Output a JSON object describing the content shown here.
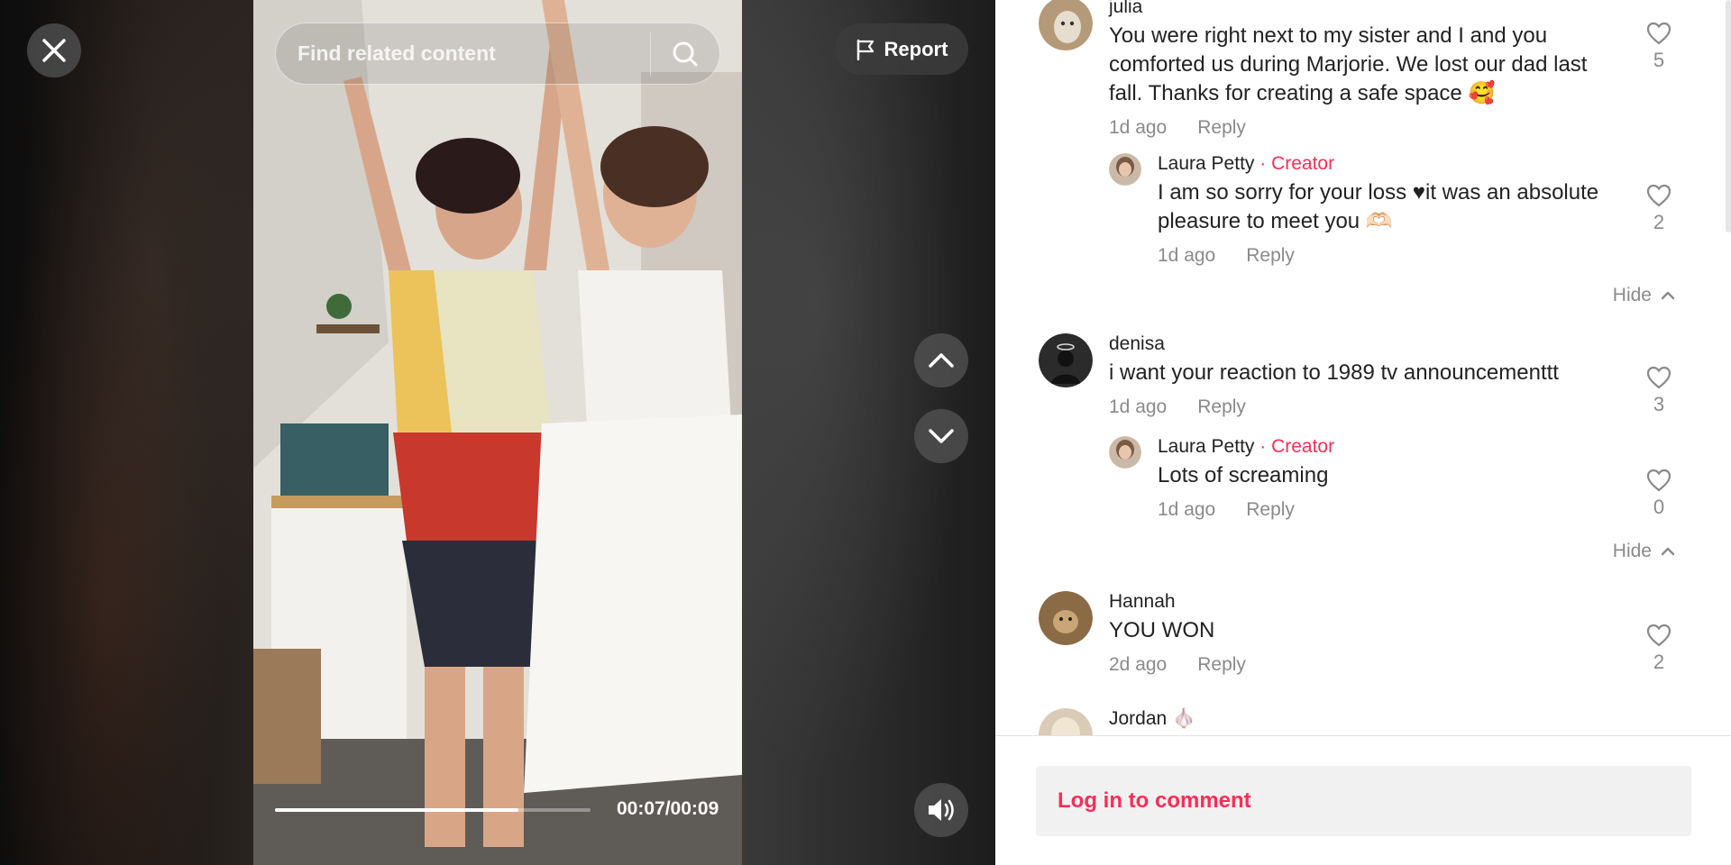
{
  "video": {
    "close_icon": "close-icon",
    "search_placeholder": "Find related content",
    "search_icon": "search-icon",
    "report_label": "Report",
    "report_icon": "flag-icon",
    "nav_up_icon": "chevron-up-icon",
    "nav_down_icon": "chevron-down-icon",
    "volume_icon": "volume-icon",
    "progress": 0.77,
    "time": "00:07/00:09"
  },
  "comments": [
    {
      "user": "julia",
      "text": "You were right next to my sister and I and you comforted us during Marjorie. We lost our dad last fall. Thanks for creating a safe space 🥰",
      "time": "1d ago",
      "reply_label": "Reply",
      "likes": "5",
      "avatar_color": "#b59a79",
      "replies": [
        {
          "user": "Laura Petty",
          "badge": "· Creator",
          "text": "I am so sorry for your loss ♥it was an absolute pleasure to meet you 🫶🏻",
          "time": "1d ago",
          "reply_label": "Reply",
          "likes": "2"
        }
      ],
      "hide_label": "Hide"
    },
    {
      "user": "denisa",
      "text": "i want your reaction to 1989 tv announcementtt",
      "time": "1d ago",
      "reply_label": "Reply",
      "likes": "3",
      "avatar_color": "#2b2b2b",
      "replies": [
        {
          "user": "Laura Petty",
          "badge": "· Creator",
          "text": "Lots of screaming",
          "time": "1d ago",
          "reply_label": "Reply",
          "likes": "0"
        }
      ],
      "hide_label": "Hide"
    },
    {
      "user": "Hannah",
      "text": "YOU WON ",
      "time": "2d ago",
      "reply_label": "Reply",
      "likes": "2",
      "avatar_color": "#8a6b46"
    },
    {
      "user": "Jordan 🧄",
      "avatar_color": "#d9cbb5"
    }
  ],
  "login": {
    "label": "Log in to comment"
  },
  "colors": {
    "accent": "#fe2c55",
    "muted": "#8a8a8a",
    "text": "#222222"
  }
}
